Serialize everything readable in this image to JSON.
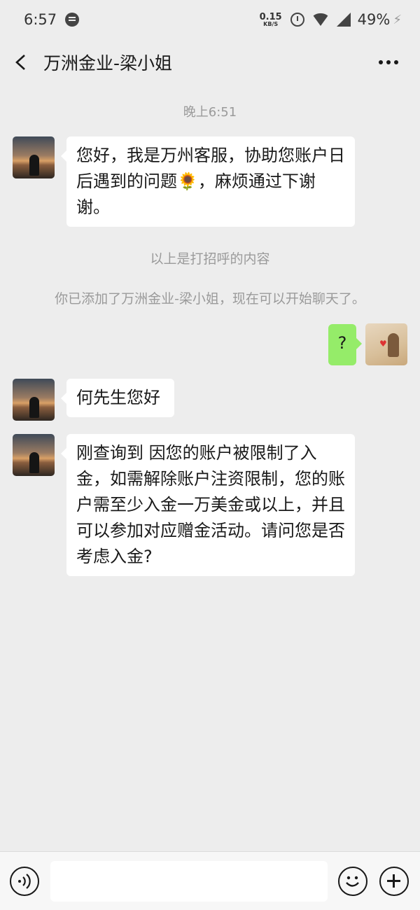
{
  "status_bar": {
    "time": "6:57",
    "net_speed": "0.15",
    "net_unit": "KB/S",
    "battery": "49%"
  },
  "header": {
    "title": "万洲金业-梁小姐"
  },
  "chat": {
    "timestamp": "晚上6:51",
    "message_1": "您好，我是万州客服，协助您账户日后遇到的问题🌻，麻烦通过下谢谢。",
    "system_1": "以上是打招呼的内容",
    "system_2": "你已添加了万洲金业-梁小姐，现在可以开始聊天了。",
    "message_self": "?",
    "message_2": "何先生您好",
    "message_3": "刚查询到 因您的账户被限制了入金，如需解除账户注资限制，您的账户需至少入金一万美金或以上，并且可以参加对应赠金活动。请问您是否考虑入金?"
  },
  "input": {
    "value": ""
  }
}
